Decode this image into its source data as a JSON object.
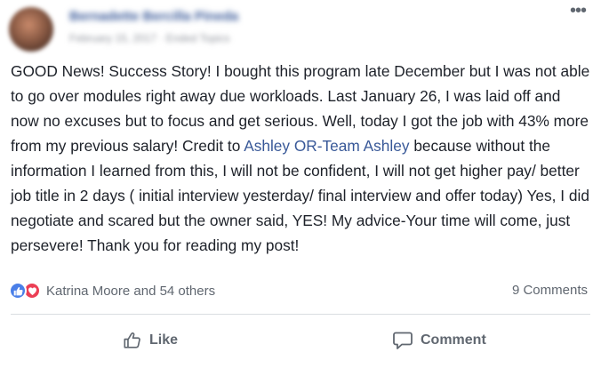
{
  "post": {
    "author_name": "Bernadette Bercilla Pineda",
    "meta": "February 15, 2017 · Ended Topics",
    "more_label": "•••",
    "text_part1": "GOOD News! Success Story! I bought this program late December but I was not able to go over modules right away due workloads. Last January 26, I was laid off and now no excuses but to focus and get serious. Well, today I got the job with 43% more from my previous salary! Credit to ",
    "mention": "Ashley OR-Team Ashley",
    "text_part2": " because without the information I learned from this, I will not be confident, I will not get higher pay/ better job title in 2 days ( initial interview yesterday/ final interview and offer today) Yes, I did negotiate and scared but the owner said, YES! My advice-Your time will come, just persevere! Thank you for reading my post!"
  },
  "reactions": {
    "names": "Katrina Moore and 54 others",
    "icons": [
      "like-reaction-icon",
      "love-reaction-icon"
    ],
    "like_color": "#4a7fe8",
    "love_color": "#ec3f55"
  },
  "comments": {
    "count_label": "9 Comments"
  },
  "actions": {
    "like_label": "Like",
    "comment_label": "Comment"
  },
  "colors": {
    "link": "#385898",
    "text": "#1d2129",
    "secondary": "#606770",
    "divider": "#dadde1"
  }
}
